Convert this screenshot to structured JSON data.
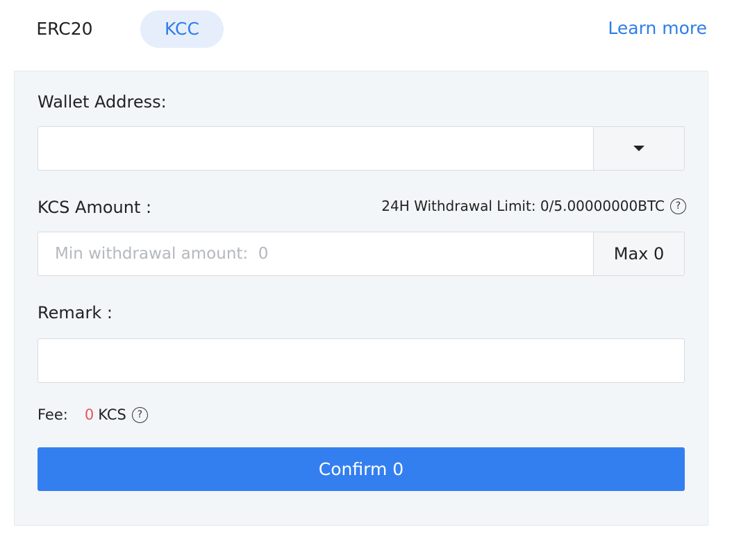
{
  "tabs": {
    "erc20": "ERC20",
    "kcc": "KCC",
    "active": "KCC"
  },
  "learn_more": "Learn more",
  "form": {
    "wallet_address_label": "Wallet Address:",
    "wallet_address_value": "",
    "amount_label": "KCS Amount :",
    "withdrawal_limit": "24H Withdrawal Limit: 0/5.00000000BTC",
    "amount_placeholder": "Min withdrawal amount:  0",
    "max_label": "Max 0",
    "remark_label": "Remark :",
    "remark_value": "",
    "fee_label": "Fee:",
    "fee_value": "0",
    "fee_unit": "KCS",
    "confirm_label": "Confirm 0"
  },
  "icons": {
    "help": "?",
    "dropdown": "caret-down-icon"
  },
  "colors": {
    "accent": "#2f7de8",
    "button": "#347ff0",
    "fee_value": "#e05a5a",
    "panel_bg": "#f3f6f8",
    "active_tab_bg": "#e6eefb"
  }
}
